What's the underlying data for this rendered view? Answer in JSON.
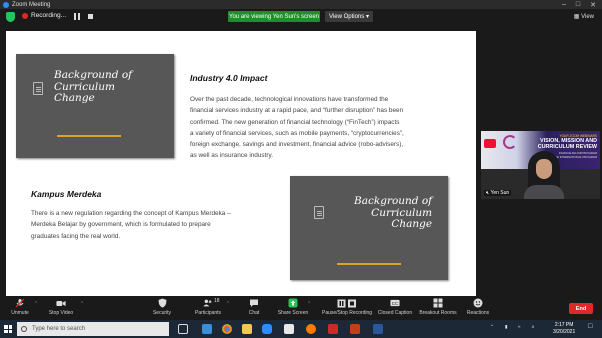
{
  "window": {
    "title": "Zoom Meeting"
  },
  "topbar": {
    "recording_label": "Recording...",
    "viewing_label": "You are viewing Yen Sun's screen",
    "view_options_label": "View Options",
    "view_label": "View"
  },
  "slide": {
    "card1": {
      "title_l1": "Background of",
      "title_l2": "Curriculum",
      "title_l3": "Change"
    },
    "card2": {
      "title_l1": "Background of",
      "title_l2": "Curriculum",
      "title_l3": "Change"
    },
    "section1": {
      "heading": "Industry 4.0 Impact",
      "lines": [
        "Over the past decade, technological innovations have transformed the",
        "financial services industry at a rapid pace, and “further disruption” has been",
        "confirmed. The new generation of financial technology (“FinTech”) impacts",
        "a variety of financial services, such as mobile payments, “cryptocurrencies”,",
        "foreign exchange, savings and investment, financial advice (robo-advisers),",
        "as well as insurance industry."
      ]
    },
    "section2": {
      "heading": "Kampus Merdeka",
      "lines": [
        "There is a new regulation regarding the concept of Kampus Merdeka –",
        "Merdeka Belajar by government, which is formulated to prepare",
        "graduates facing the real world."
      ]
    }
  },
  "video": {
    "banner_top": "YOUR ZOOM WEBINARS",
    "banner_title_l1": "VISION, MISSION AND",
    "banner_title_l2": "CURRICULUM REVIEW",
    "banner_sub_l1": "FINANCE MAJOR PROGRAM",
    "banner_sub_l2": "FINANCE INTERNATIONAL PROGRAM",
    "participant_name": "Yen Sun"
  },
  "toolbar": {
    "unmute": "Unmute",
    "stop_video": "Stop Video",
    "security": "Security",
    "participants": "Participants",
    "participants_count": "18",
    "chat": "Chat",
    "share_screen": "Share Screen",
    "pause_stop_recording": "Pause/Stop Recording",
    "closed_caption": "Closed Caption",
    "breakout_rooms": "Breakout Rooms",
    "reactions": "Reactions",
    "end": "End"
  },
  "taskbar": {
    "search_placeholder": "Type here to search",
    "time": "2:17 PM",
    "date": "3/20/2021"
  },
  "colors": {
    "accent_green": "#1f8f2e",
    "card_bg": "#575757",
    "card_line": "#d9a521",
    "end_red": "#e02828"
  }
}
